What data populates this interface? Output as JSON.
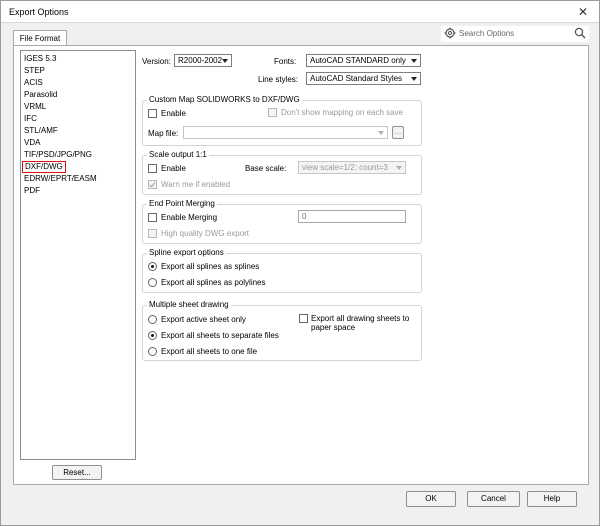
{
  "window": {
    "title": "Export Options",
    "close_label": "✕"
  },
  "tabs": {
    "file_format": "File Format"
  },
  "search": {
    "placeholder": "Search Options"
  },
  "formats": {
    "items": [
      "IGES 5.3",
      "STEP",
      "ACIS",
      "Parasolid",
      "VRML",
      "IFC",
      "STL/AMF",
      "VDA",
      "TIF/PSD/JPG/PNG",
      "DXF/DWG",
      "EDRW/EPRT/EASM",
      "PDF"
    ],
    "selected": "DXF/DWG"
  },
  "version": {
    "label": "Version:",
    "value": "R2000-2002"
  },
  "fonts": {
    "label": "Fonts:",
    "value": "AutoCAD STANDARD only"
  },
  "line_styles": {
    "label": "Line styles:",
    "value": "AutoCAD Standard Styles"
  },
  "custom_map": {
    "title": "Custom Map SOLIDWORKS to DXF/DWG",
    "enable": "Enable",
    "dont_show": "Don't show mapping on each save",
    "map_file_label": "Map file:",
    "map_file_value": "",
    "browse": "..."
  },
  "scale": {
    "title": "Scale output 1:1",
    "enable": "Enable",
    "base_scale_label": "Base scale:",
    "base_scale_value": "view scale=1/2: count=3",
    "warn": "Warn me if enabled"
  },
  "merging": {
    "title": "End Point Merging",
    "enable": "Enable Merging",
    "value": "0",
    "high_quality": "High quality DWG export"
  },
  "spline": {
    "title": "Spline export options",
    "opt1": "Export all splines as splines",
    "opt2": "Export all splines as polylines"
  },
  "multi": {
    "title": "Multiple sheet drawing",
    "opt1": "Export active sheet only",
    "opt2": "Export all sheets to separate files",
    "opt3": "Export all sheets to one file",
    "paper_space": "Export all drawing sheets to paper space"
  },
  "buttons": {
    "reset": "Reset...",
    "ok": "OK",
    "cancel": "Cancel",
    "help": "Help"
  },
  "colors": {
    "selection_outline": "#dd1111",
    "panel_bg": "#ffffff",
    "window_bg": "#f0f0f0"
  }
}
